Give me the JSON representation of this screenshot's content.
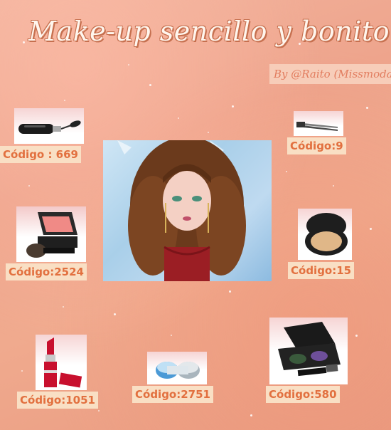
{
  "header": {
    "title": "Make-up sencillo y bonito",
    "byline": "By @Raito (Missmoda)"
  },
  "colors": {
    "label_bg": "#f9dfc4",
    "label_text": "#e2703f",
    "background": "#eea48c",
    "byline_text": "#e27d5f"
  },
  "items": [
    {
      "name": "mascara",
      "icon": "mascara-icon",
      "label": "Código : 669"
    },
    {
      "name": "tweezers",
      "icon": "tweezers-icon",
      "label": "Código:9"
    },
    {
      "name": "blush",
      "icon": "blush-compact-icon",
      "label": "Código:2524"
    },
    {
      "name": "powder",
      "icon": "powder-compact-icon",
      "label": "Código:15"
    },
    {
      "name": "lipstick",
      "icon": "lipstick-icon",
      "label": "Código:1051"
    },
    {
      "name": "contact-lenses",
      "icon": "contact-lens-case-icon",
      "label": "Código:2751"
    },
    {
      "name": "eyeshadow",
      "icon": "eyeshadow-palette-icon",
      "label": "Código:580"
    }
  ]
}
